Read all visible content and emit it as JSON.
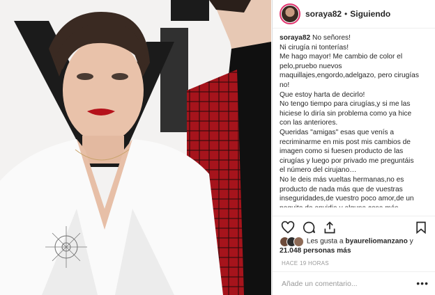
{
  "post": {
    "username": "soraya82",
    "separator": "•",
    "follow_status": "Siguiendo",
    "caption_lines": [
      "No señores!",
      "Ni cirugía ni tonterías!",
      "Me hago mayor! Me cambio de color el pelo,pruebo nuevos maquillajes,engordo,adelgazo, pero cirugías no!",
      "Que estoy harta de decirlo!",
      "No tengo tiempo para cirugías,y si me las hiciese lo diría sin problema como ya hice con las anteriores.",
      "Queridas \"amigas\" esas que venís a recriminarme en mis post mis cambios de imagen como si fuesen producto de las cirugías y luego por privado me preguntáis el número del cirujano…",
      "No le deis más vueltas hermanas,no es producto de nada más que de vuestras inseguridades,de vuestro poco amor,de un poquito de envidia y alguna cosa más Sabra"
    ],
    "likes_text_prefix": "Les gusta a ",
    "likes_user": "byaureliomanzano",
    "likes_text_and": " y ",
    "likes_count": "21.048 personas más",
    "timestamp": "HACE 19 HORAS",
    "comment_placeholder": "Añade un comentario...",
    "more_options": "•••"
  },
  "icons": {
    "like": "heart-icon",
    "comment": "comment-icon",
    "share": "share-icon",
    "save": "bookmark-icon"
  },
  "colors": {
    "text": "#262626",
    "muted": "#999999",
    "story_ring": "#e1306c",
    "divider": "#efefef"
  }
}
